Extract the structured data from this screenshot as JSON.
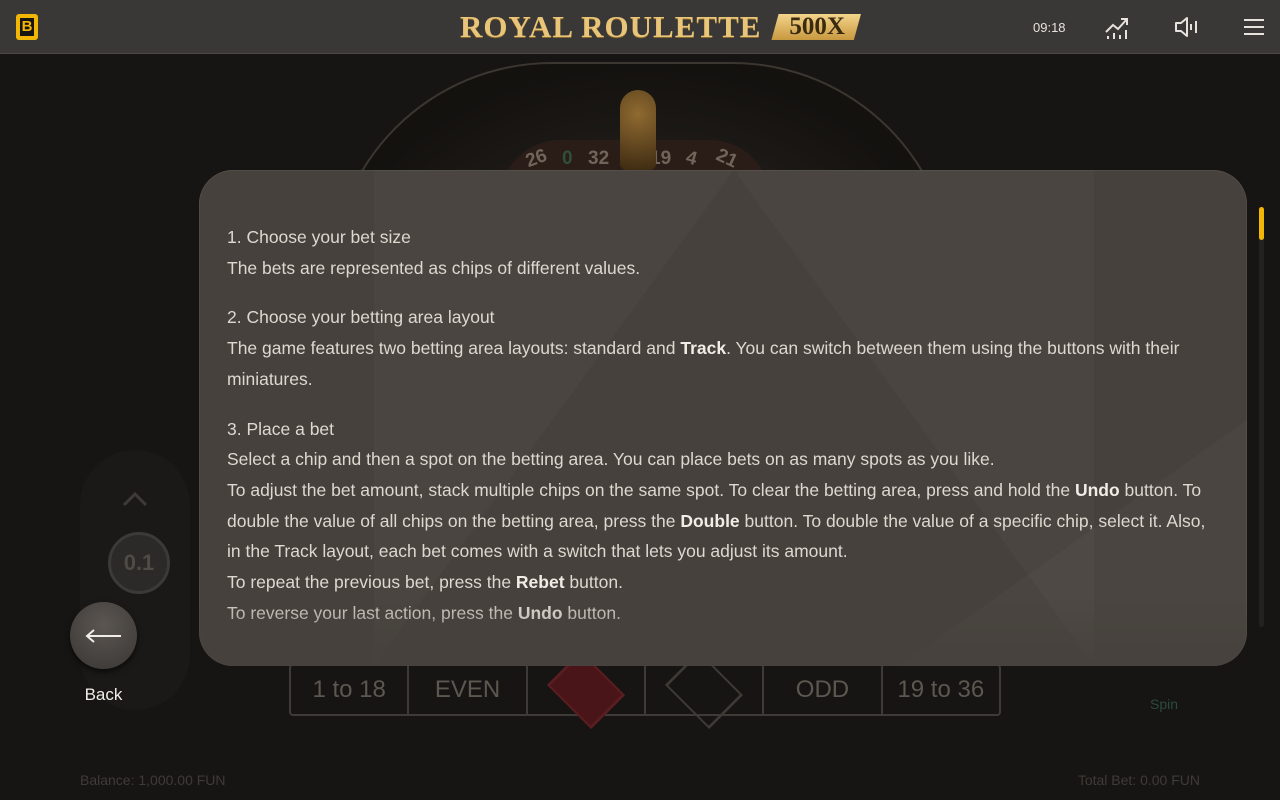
{
  "header": {
    "brand_badge": "B",
    "logo_text": "ROYAL ROULETTE",
    "logo_multiplier": "500X",
    "clock": "09:18",
    "icons": [
      "stats-icon",
      "sound-icon",
      "menu-icon"
    ]
  },
  "background_game": {
    "wheel_numbers": [
      "26",
      "0",
      "32",
      "19",
      "4",
      "21"
    ],
    "bet_row": [
      "1 to 18",
      "EVEN",
      "",
      "",
      "ODD",
      "19 to 36"
    ],
    "chip_value": "0.1",
    "balance_label": "Balance: 1,000.00 FUN",
    "total_bet_label": "Total Bet: 0.00 FUN",
    "spin_label": "Spin"
  },
  "rules": {
    "sections": [
      {
        "heading": "1. Choose your bet size",
        "lines": [
          [
            {
              "t": "The bets are represented as chips of different values."
            }
          ]
        ]
      },
      {
        "heading": "2. Choose your betting area layout",
        "lines": [
          [
            {
              "t": "The game features two betting area layouts: standard and "
            },
            {
              "t": "Track",
              "b": true
            },
            {
              "t": ". You can switch between them using the buttons with their miniatures."
            }
          ]
        ]
      },
      {
        "heading": "3. Place a bet",
        "lines": [
          [
            {
              "t": "Select a chip and then a spot on the betting area. You can place bets on as many spots as you like."
            }
          ],
          [
            {
              "t": "To adjust the bet amount, stack multiple chips on the same spot. To clear the betting area, press and hold the "
            },
            {
              "t": "Undo",
              "b": true
            },
            {
              "t": " button. To double the value of all chips on the betting area, press the "
            },
            {
              "t": "Double",
              "b": true
            },
            {
              "t": " button. To double the value of a specific chip, select it. Also, in the Track layout, each bet comes with a switch that lets you adjust its amount."
            }
          ],
          [
            {
              "t": "To repeat the previous bet, press the "
            },
            {
              "t": "Rebet",
              "b": true
            },
            {
              "t": " button."
            }
          ],
          [
            {
              "t": "To reverse your last action, press the "
            },
            {
              "t": "Undo",
              "b": true
            },
            {
              "t": " button."
            }
          ]
        ]
      }
    ],
    "scroll_position": 0.0
  },
  "back_button": {
    "label": "Back"
  },
  "colors": {
    "accent": "#f2b705",
    "modal_bg": "#46413c",
    "topbar_bg": "#3a3836"
  }
}
